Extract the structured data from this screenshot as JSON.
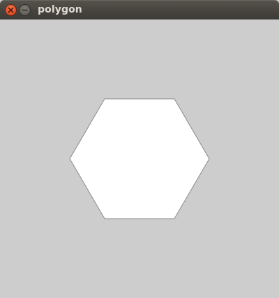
{
  "window": {
    "title": "polygon"
  },
  "titlebar_buttons": [
    {
      "name": "close",
      "icon": "close-icon",
      "color": "#e9542a"
    },
    {
      "name": "minimize",
      "icon": "minimize-icon",
      "color": "#67645e"
    }
  ],
  "canvas": {
    "background_color": "#cdcdcd",
    "shape": {
      "type": "polygon",
      "sides": 6,
      "fill_color": "#ffffff",
      "stroke_color": "#8a8a8a"
    }
  }
}
